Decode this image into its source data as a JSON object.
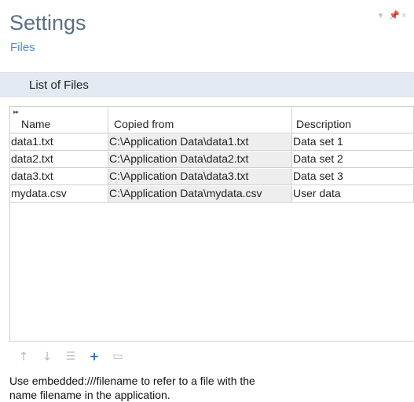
{
  "header": {
    "title": "Settings",
    "subtitle": "Files",
    "controls": {
      "minimize_label": "▾",
      "pin_label": "📌",
      "close_label": "×"
    }
  },
  "section": {
    "title": "List of Files"
  },
  "table": {
    "columns": [
      {
        "label": "Name"
      },
      {
        "label": "Copied from"
      },
      {
        "label": "Description"
      }
    ],
    "rows": [
      {
        "name": "data1.txt",
        "copied_from": "C:\\Application Data\\data1.txt",
        "description": "Data set 1"
      },
      {
        "name": "data2.txt",
        "copied_from": "C:\\Application Data\\data2.txt",
        "description": "Data set 2"
      },
      {
        "name": "data3.txt",
        "copied_from": "C:\\Application Data\\data3.txt",
        "description": "Data set 3"
      },
      {
        "name": "mydata.csv",
        "copied_from": "C:\\Application Data\\mydata.csv",
        "description": "User data"
      }
    ]
  },
  "toolbar": {
    "move_up_icon": "↑",
    "move_down_icon": "↓",
    "delete_icon": "☰",
    "add_icon": "+",
    "more_icon": "▭"
  },
  "info": {
    "line1": "Use embedded:///filename to refer to a file with the",
    "line2": "name filename in the application."
  }
}
